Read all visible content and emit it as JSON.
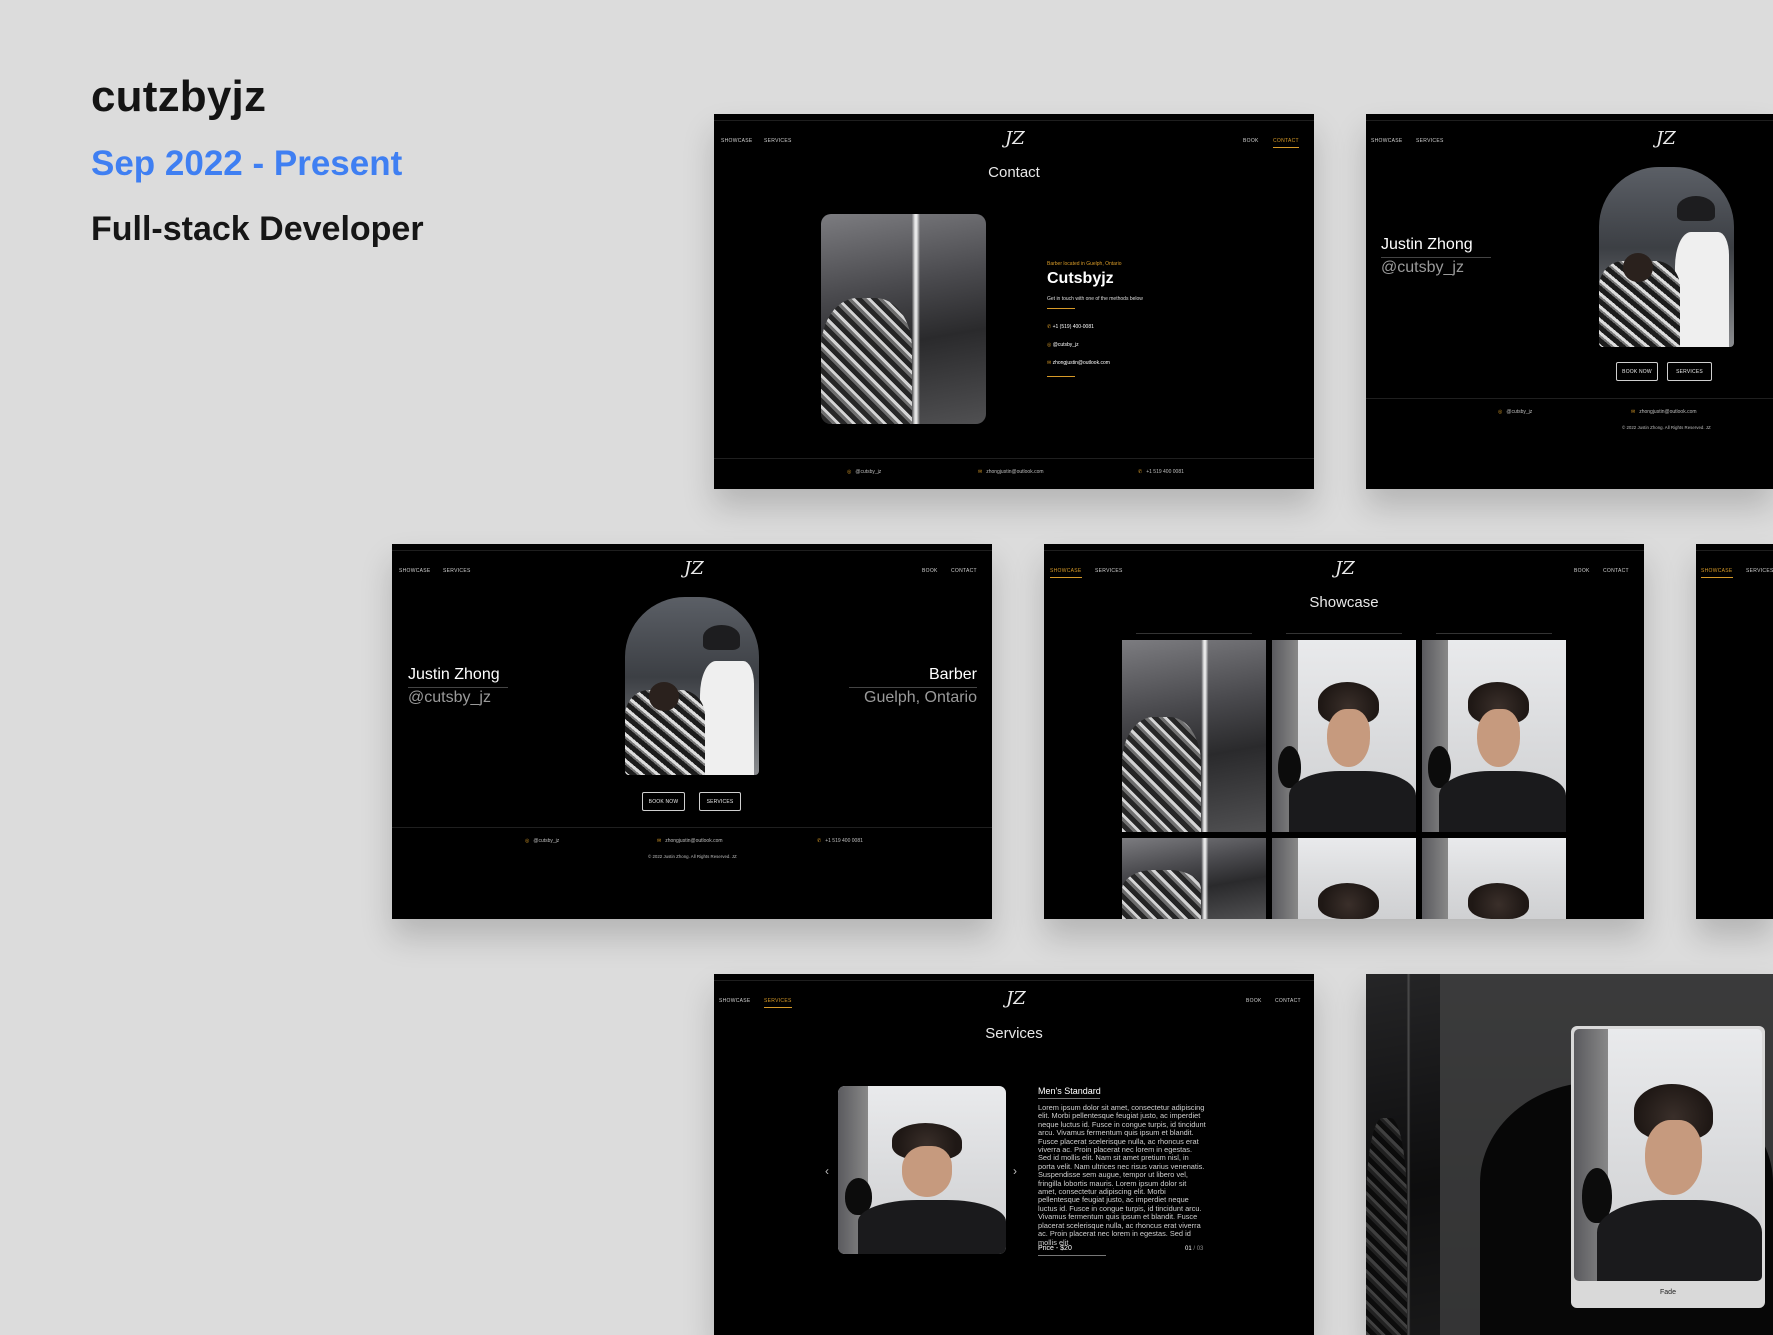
{
  "header": {
    "title": "cutzbyjz",
    "period": "Sep 2022 - Present",
    "role": "Full-stack Developer"
  },
  "colors": {
    "accent": "#3f7ff2",
    "site_gold": "#d79a28",
    "bg": "#dcdcdc"
  },
  "site": {
    "logo": "JZ",
    "nav": {
      "showcase": "SHOWCASE",
      "services": "SERVICES",
      "book": "BOOK",
      "contact": "CONTACT"
    },
    "footer": {
      "instagram": "@cutsby_jz",
      "email": "zhongjustin@outlook.com",
      "phone": "+1 519 400 0081",
      "copyright": "© 2022 Justin Zhong. All Rights Reserved. JZ"
    }
  },
  "contact_page": {
    "title": "Contact",
    "eyebrow": "Barber located in Guelph, Ontario",
    "brand": "Cutsbyjz",
    "intro": "Get in touch with one of the methods below",
    "phone": "+1 (519) 400-0081",
    "instagram": "@cutsby_jz",
    "email": "zhongjustin@outlook.com"
  },
  "home_page": {
    "name": "Justin Zhong",
    "handle": "@cutsby_jz",
    "role": "Barber",
    "location": "Guelph, Ontario",
    "book_label": "BOOK NOW",
    "services_label": "SERVICES"
  },
  "showcase_page": {
    "title": "Showcase"
  },
  "services_page": {
    "title": "Services",
    "service_name": "Men's Standard",
    "description": "Lorem ipsum dolor sit amet, consectetur adipiscing elit. Morbi pellentesque feugiat justo, ac imperdiet neque luctus id. Fusce in congue turpis, id tincidunt arcu. Vivamus fermentum quis ipsum et blandit. Fusce placerat scelerisque nulla, ac rhoncus erat viverra ac. Proin placerat nec lorem in egestas. Sed id mollis elit. Nam sit amet pretium nisl, in porta velit. Nam ultrices nec risus varius venenatis. Suspendisse sem augue, tempor ut libero vel, fringilla lobortis mauris. Lorem ipsum dolor sit amet, consectetur adipiscing elit. Morbi pellentesque feugiat justo, ac imperdiet neque luctus id. Fusce in congue turpis, id tincidunt arcu. Vivamus fermentum quis ipsum et blandit. Fusce placerat scelerisque nulla, ac rhoncus erat viverra ac. Proin placerat nec lorem in egestas. Sed id mollis elit",
    "price": "Price - $20",
    "counter_current": "01",
    "counter_total": "/ 03",
    "prev": "‹",
    "next": "›"
  },
  "lightbox": {
    "caption": "Fade"
  }
}
